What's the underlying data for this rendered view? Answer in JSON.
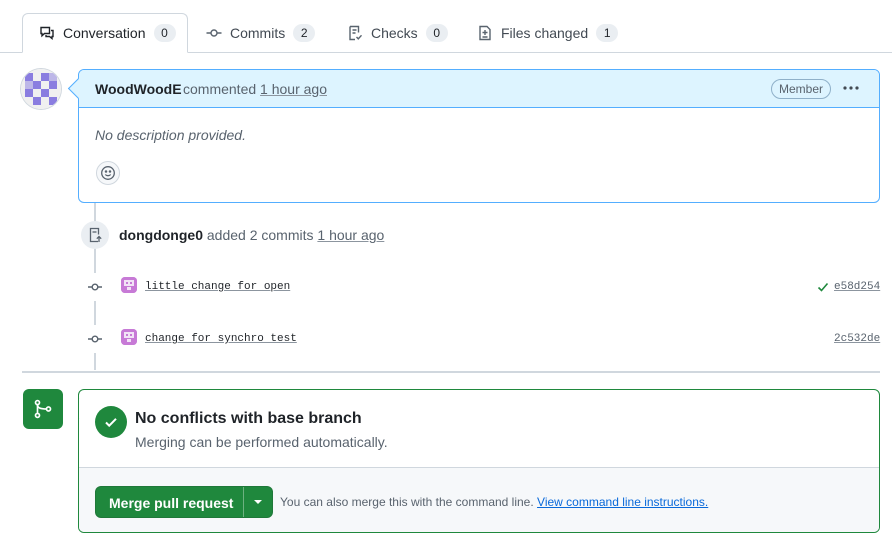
{
  "tabs": [
    {
      "label": "Conversation",
      "count": "0",
      "icon": "comment-discussion-icon",
      "active": true
    },
    {
      "label": "Commits",
      "count": "2",
      "icon": "git-commit-icon"
    },
    {
      "label": "Checks",
      "count": "0",
      "icon": "checklist-icon"
    },
    {
      "label": "Files changed",
      "count": "1",
      "icon": "file-diff-icon"
    }
  ],
  "comment": {
    "author": "WoodWoodE",
    "action": "commented",
    "time": "1 hour ago",
    "badge": "Member",
    "body": "No description provided."
  },
  "event": {
    "actor": "dongdonge0",
    "action": "added 2 commits",
    "time": "1 hour ago"
  },
  "commits": [
    {
      "message": "little change for open",
      "sha": "e58d254",
      "status": "success"
    },
    {
      "message": "change for synchro test",
      "sha": "2c532de",
      "status": ""
    }
  ],
  "merge": {
    "title": "No conflicts with base branch",
    "subtitle": "Merging can be performed automatically.",
    "button_label": "Merge pull request",
    "cli_text": "You can also merge this with the command line.",
    "cli_link": "View command line instructions."
  },
  "colors": {
    "accent_blue": "#0969da",
    "success_green": "#1f883d",
    "comment_header_bg": "#ddf4ff"
  }
}
